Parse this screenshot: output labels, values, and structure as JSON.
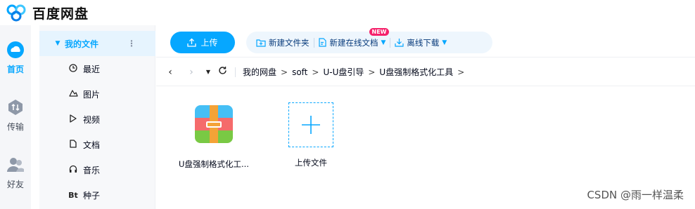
{
  "app": {
    "brand": "百度网盘"
  },
  "rail": [
    {
      "label": "首页",
      "icon": "cloud-icon",
      "active": true
    },
    {
      "label": "传输",
      "icon": "transfer-icon",
      "active": false
    },
    {
      "label": "好友",
      "icon": "friends-icon",
      "active": false
    }
  ],
  "sidebar": {
    "items": [
      {
        "label": "我的文件",
        "icon": "triangle-down-icon",
        "active": true,
        "more": "⋮"
      },
      {
        "label": "最近",
        "icon": "clock-icon"
      },
      {
        "label": "图片",
        "icon": "image-icon"
      },
      {
        "label": "视频",
        "icon": "play-icon"
      },
      {
        "label": "文档",
        "icon": "document-icon"
      },
      {
        "label": "音乐",
        "icon": "headphones-icon"
      },
      {
        "label": "种子",
        "icon": "bt-icon",
        "glyph": "Bt"
      }
    ]
  },
  "toolbar": {
    "upload_label": "上传",
    "new_folder_label": "新建文件夹",
    "new_online_doc_label": "新建在线文档",
    "new_badge": "NEW",
    "offline_download_label": "离线下载"
  },
  "breadcrumb": [
    "我的网盘",
    "soft",
    "U-U盘引导",
    "U盘强制格式化工具"
  ],
  "files": [
    {
      "name": "U盘强制格式化工...",
      "type": "zip"
    }
  ],
  "upload_tile": {
    "label": "上传文件"
  },
  "watermark": "CSDN @雨一样温柔",
  "colors": {
    "accent": "#06a7ff",
    "badge": "#f5226b",
    "sidebar_active_bg": "#e6f4fe"
  }
}
